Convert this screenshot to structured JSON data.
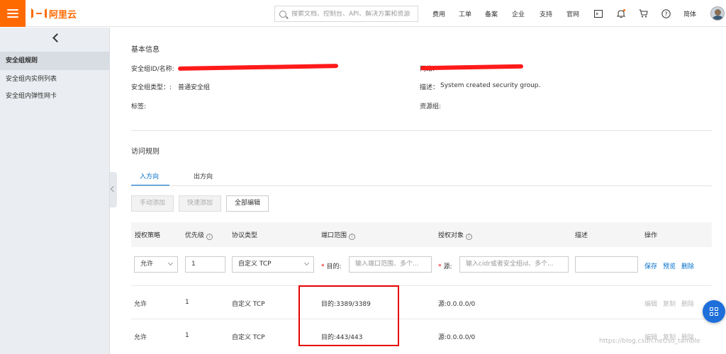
{
  "brand": {
    "name": "阿里云",
    "accent": "#ff6a00"
  },
  "search": {
    "placeholder": "搜索文档、控制台、API、解决方案和资源"
  },
  "topnav": [
    "费用",
    "工单",
    "备案",
    "企业",
    "支持",
    "官网"
  ],
  "topicons": [
    "terminal-icon",
    "bell-icon",
    "cart-icon",
    "help-icon"
  ],
  "lang": "简体",
  "sidebar": {
    "items": [
      {
        "label": "安全组规则"
      },
      {
        "label": "安全组内实例列表"
      },
      {
        "label": "安全组内弹性网卡"
      }
    ]
  },
  "basic": {
    "title": "基本信息",
    "id_label": "安全组ID/名称:",
    "network_label": "网络:",
    "type_label": "安全组类型：:",
    "type_value": "普通安全组",
    "desc_label": "描述：",
    "desc_value": "System created security group.",
    "tags_label": "标签:",
    "rg_label": "资源组:"
  },
  "rules": {
    "title": "访问规则",
    "tabs": [
      "入方向",
      "出方向"
    ],
    "buttons": {
      "manual_add": "手动添加",
      "quick_add": "快速添加",
      "edit_all": "全部编辑"
    },
    "headers": {
      "policy": "授权策略",
      "priority": "优先级",
      "protocol": "协议类型",
      "port": "端口范围",
      "object": "授权对象",
      "desc": "描述",
      "ops": "操作"
    },
    "new_row": {
      "policy": "允许",
      "priority": "1",
      "protocol": "自定义 TCP",
      "dest_label": "目的:",
      "port_placeholder": "输入端口范围、多个...",
      "src_label": "源:",
      "object_placeholder": "输入cidr或者安全组id、多个...",
      "save": "保存",
      "preview": "预览",
      "delete": "删除"
    },
    "rows": [
      {
        "policy": "允许",
        "priority": "1",
        "protocol": "自定义 TCP",
        "port": "目的:3389/3389",
        "object": "源:0.0.0.0/0",
        "edit": "编辑",
        "copy": "复制",
        "delete": "删除"
      },
      {
        "policy": "允许",
        "priority": "1",
        "protocol": "自定义 TCP",
        "port": "目的:443/443",
        "object": "源:0.0.0.0/0",
        "edit": "编辑",
        "copy": "复制",
        "delete": "删除"
      }
    ]
  },
  "watermark": "https://blog.csdn.net/so_tamble"
}
